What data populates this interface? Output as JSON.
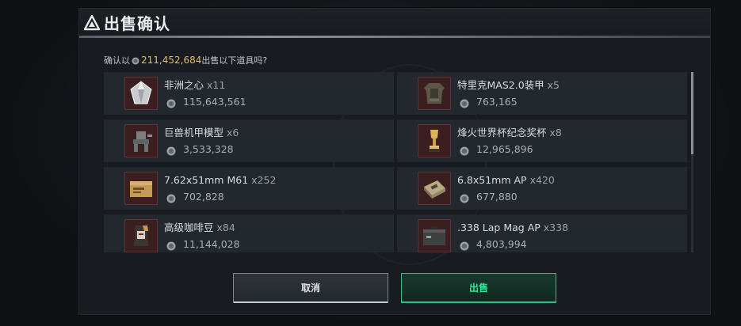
{
  "dialog": {
    "title": "出售确认",
    "prompt_prefix": "确认以",
    "total_amount": "211,452,684",
    "prompt_suffix": "出售以下道具吗?",
    "cancel_label": "取消",
    "sell_label": "出售"
  },
  "items": [
    {
      "name": "非洲之心",
      "qty": "x11",
      "price": "115,643,561",
      "icon": "diamond-icon"
    },
    {
      "name": "特里克MAS2.0装甲",
      "qty": "x5",
      "price": "763,165",
      "icon": "armor-icon"
    },
    {
      "name": "巨兽机甲模型",
      "qty": "x6",
      "price": "3,533,328",
      "icon": "mech-model-icon"
    },
    {
      "name": "烽火世界杯纪念奖杯",
      "qty": "x8",
      "price": "12,965,896",
      "icon": "trophy-icon"
    },
    {
      "name": "7.62x51mm M61",
      "qty": "x252",
      "price": "702,828",
      "icon": "ammo-box-icon"
    },
    {
      "name": "6.8x51mm AP",
      "qty": "x420",
      "price": "677,880",
      "icon": "ammo-pack-icon"
    },
    {
      "name": "高级咖啡豆",
      "qty": "x84",
      "price": "11,144,028",
      "icon": "coffee-bag-icon"
    },
    {
      "name": ".338 Lap Mag AP",
      "qty": "x338",
      "price": "4,803,994",
      "icon": "ammo-can-icon"
    }
  ],
  "colors": {
    "amount": "#e2bf56",
    "sell_accent": "#2fbf83",
    "item_bg": "#22282d",
    "thumb_bg": "#3a1e20"
  }
}
